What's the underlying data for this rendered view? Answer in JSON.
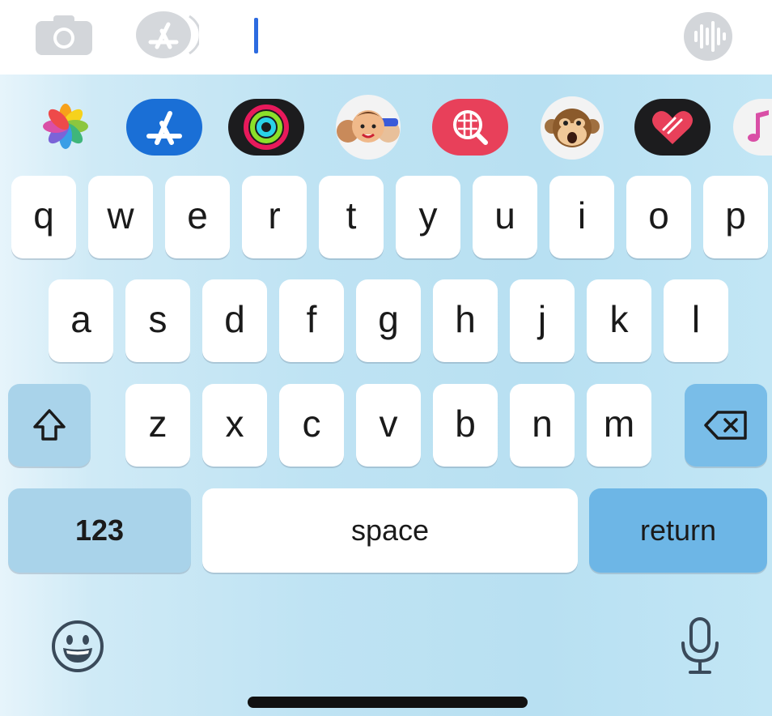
{
  "input": {
    "text": ""
  },
  "keyboard": {
    "row1": [
      "q",
      "w",
      "e",
      "r",
      "t",
      "y",
      "u",
      "i",
      "o",
      "p"
    ],
    "row2": [
      "a",
      "s",
      "d",
      "f",
      "g",
      "h",
      "j",
      "k",
      "l"
    ],
    "row3": [
      "z",
      "x",
      "c",
      "v",
      "b",
      "n",
      "m"
    ],
    "numbers_label": "123",
    "space_label": "space",
    "return_label": "return"
  },
  "apps": [
    "photos-icon",
    "app-store-icon",
    "activity-icon",
    "memoji-icon",
    "image-search-icon",
    "monkey-emoji-icon",
    "digital-touch-icon",
    "music-icon"
  ],
  "colors": {
    "keyboard_bg": "#bfe3f3",
    "key_bg": "#ffffff",
    "special_key_bg": "#a9d3ea",
    "return_key_bg": "#6db6e6",
    "cursor": "#2d6be0",
    "app_store_blue": "#1a6fd6",
    "image_search_red": "#e8405a"
  }
}
